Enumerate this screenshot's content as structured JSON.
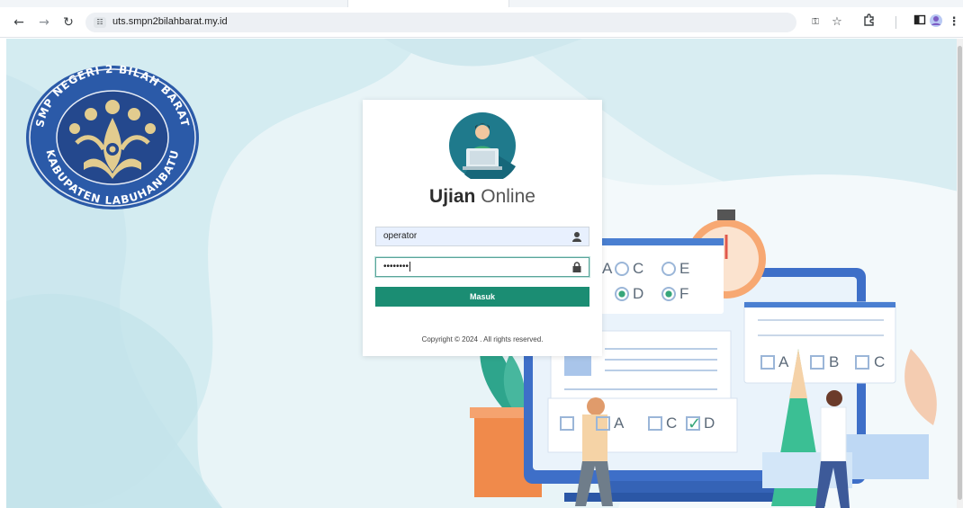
{
  "browser": {
    "url": "uts.smpn2bilahbarat.my.id",
    "site_info_icon": "tune-icon",
    "back_icon": "←",
    "forward_icon": "→",
    "reload_icon": "↻"
  },
  "logo": {
    "ring_text_top": "SMP NEGERI 2 BILAH BARAT",
    "ring_text_bottom": "KABUPATEN LABUHANBATU"
  },
  "login": {
    "brand_bold": "Ujian",
    "brand_light": "Online",
    "username_value": "operator",
    "password_value": "••••••••",
    "submit_label": "Masuk",
    "copyright": "Copyright © 2024 . All rights reserved."
  },
  "illustration": {
    "options_top": [
      "C",
      "E",
      "D",
      "F"
    ],
    "options_mid": [
      "A",
      "B",
      "C"
    ],
    "options_bottom": [
      "A",
      "C",
      "D"
    ]
  },
  "colors": {
    "accent": "#1b8d73",
    "logo_blue": "#2b5aa8",
    "logo_gold": "#e2cc8f"
  }
}
